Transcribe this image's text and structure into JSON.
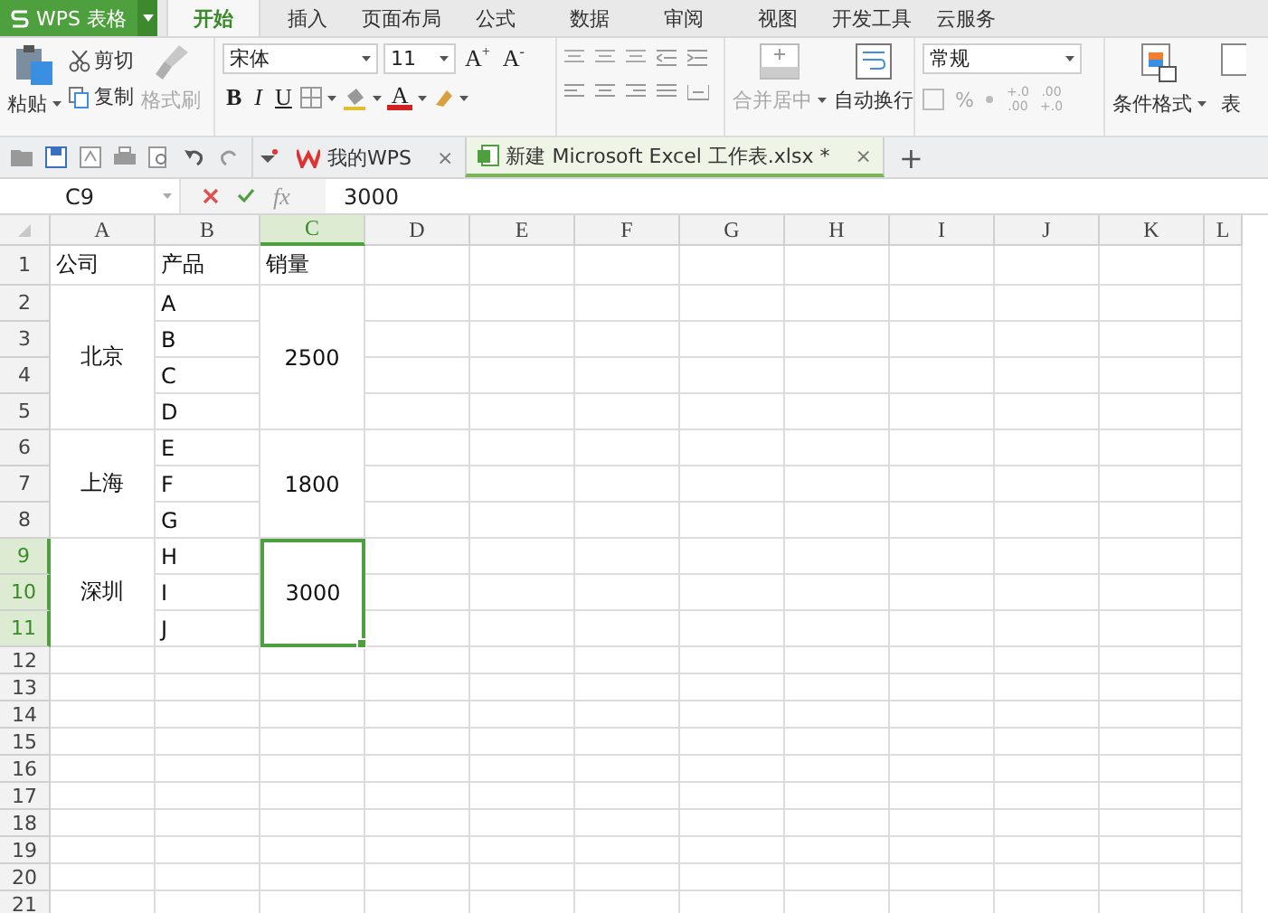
{
  "app": {
    "title": "WPS 表格"
  },
  "menu_tabs": [
    {
      "label": "开始",
      "selected": true
    },
    {
      "label": "插入",
      "selected": false
    },
    {
      "label": "页面布局",
      "selected": false
    },
    {
      "label": "公式",
      "selected": false
    },
    {
      "label": "数据",
      "selected": false
    },
    {
      "label": "审阅",
      "selected": false
    },
    {
      "label": "视图",
      "selected": false
    },
    {
      "label": "开发工具",
      "selected": false
    },
    {
      "label": "云服务",
      "selected": false
    }
  ],
  "ribbon": {
    "clipboard": {
      "paste": "粘贴",
      "cut": "剪切",
      "copy": "复制",
      "format_painter": {
        "label": "格式刷",
        "disabled": true
      }
    },
    "font": {
      "name": "宋体",
      "size": "11",
      "grow": "A$^{+}$",
      "shrink": "A$^{-}$",
      "styles": [
        "B",
        "I",
        "U"
      ],
      "font_color": "A"
    },
    "merge": {
      "label": "合并居中",
      "disabled": true
    },
    "wrap": {
      "label": "自动换行",
      "disabled": false
    },
    "number": {
      "format": "常规",
      "percent": "%",
      "decimals": [
        [
          "+.0",
          ".00"
        ],
        [
          ".00",
          "+.0"
        ]
      ],
      "disabled": true
    },
    "conditional": "条件格式",
    "table": "表"
  },
  "doc_tabs": [
    {
      "label": "我的WPS",
      "close": "×",
      "selected": false,
      "kind": "home"
    },
    {
      "label": "新建 Microsoft Excel 工作表.xlsx *",
      "close": "×",
      "selected": true,
      "kind": "sheet"
    }
  ],
  "new_tab": "+",
  "formula_bar": {
    "cell": "C9",
    "fx": "fx",
    "value": "3000"
  },
  "sheet": {
    "columns": [
      {
        "label": "A",
        "selected": false
      },
      {
        "label": "B",
        "selected": false
      },
      {
        "label": "C",
        "selected": true
      },
      {
        "label": "D",
        "selected": false
      },
      {
        "label": "E",
        "selected": false
      },
      {
        "label": "F",
        "selected": false
      },
      {
        "label": "G",
        "selected": false
      },
      {
        "label": "H",
        "selected": false
      },
      {
        "label": "I",
        "selected": false
      },
      {
        "label": "J",
        "selected": false
      },
      {
        "label": "K",
        "selected": false
      },
      {
        "label": "L",
        "selected": false
      }
    ],
    "rows": [
      {
        "label": "1",
        "selected": false
      },
      {
        "label": "2",
        "selected": false
      },
      {
        "label": "3",
        "selected": false
      },
      {
        "label": "4",
        "selected": false
      },
      {
        "label": "5",
        "selected": false
      },
      {
        "label": "6",
        "selected": false
      },
      {
        "label": "7",
        "selected": false
      },
      {
        "label": "8",
        "selected": false
      },
      {
        "label": "9",
        "selected": true
      },
      {
        "label": "10",
        "selected": true
      },
      {
        "label": "11",
        "selected": true
      },
      {
        "label": "12",
        "selected": false
      },
      {
        "label": "13",
        "selected": false
      },
      {
        "label": "14",
        "selected": false
      },
      {
        "label": "15",
        "selected": false
      },
      {
        "label": "16",
        "selected": false
      },
      {
        "label": "17",
        "selected": false
      },
      {
        "label": "18",
        "selected": false
      },
      {
        "label": "19",
        "selected": false
      },
      {
        "label": "20",
        "selected": false
      },
      {
        "label": "21",
        "selected": false
      }
    ],
    "header": [
      "公司",
      "产品",
      "销量"
    ],
    "groups": [
      {
        "company": "北京",
        "products": [
          "A",
          "B",
          "C",
          "D"
        ],
        "sales": "2500",
        "selected": false
      },
      {
        "company": "上海",
        "products": [
          "E",
          "F",
          "G"
        ],
        "sales": "1800",
        "selected": false
      },
      {
        "company": "深圳",
        "products": [
          "H",
          "I",
          "J"
        ],
        "sales": "3000",
        "selected": true
      }
    ]
  }
}
